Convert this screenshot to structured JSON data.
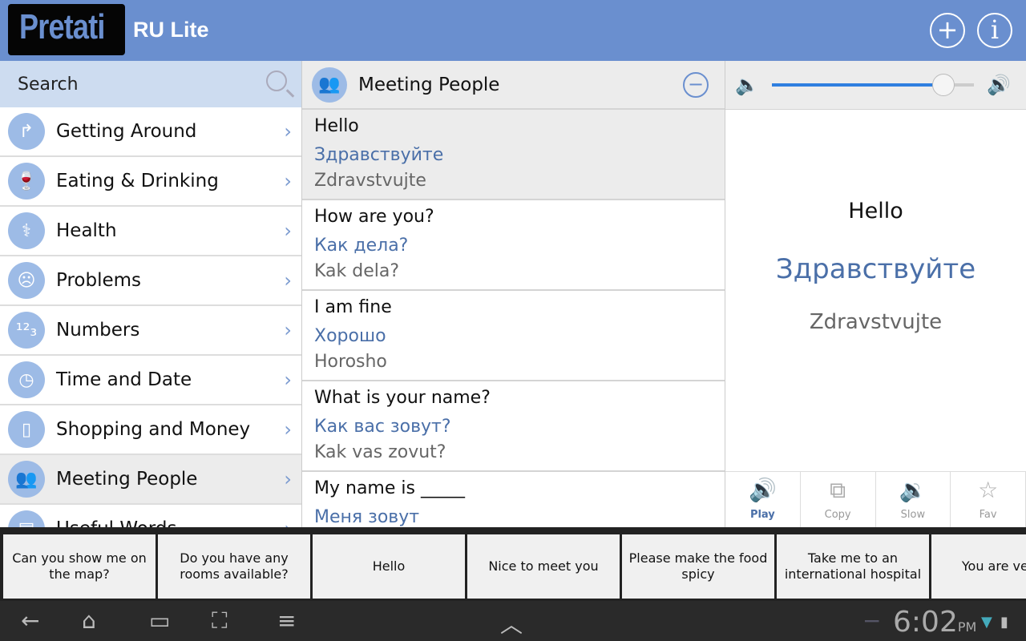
{
  "header": {
    "logo": "Pretati",
    "title": "RU Lite",
    "add_icon": "plus-circle",
    "info_icon": "info-circle"
  },
  "search": {
    "placeholder": "Search"
  },
  "categories": [
    {
      "label": "Getting Around",
      "icon": "↱"
    },
    {
      "label": "Eating & Drinking",
      "icon": "🍷"
    },
    {
      "label": "Health",
      "icon": "⚕"
    },
    {
      "label": "Problems",
      "icon": "☹"
    },
    {
      "label": "Numbers",
      "icon": "¹²₃"
    },
    {
      "label": "Time and Date",
      "icon": "◷"
    },
    {
      "label": "Shopping and Money",
      "icon": "▯"
    },
    {
      "label": "Meeting People",
      "icon": "👥"
    },
    {
      "label": "Useful Words",
      "icon": "▤"
    }
  ],
  "phrase_list": {
    "title": "Meeting People",
    "phrases": [
      {
        "en": "Hello",
        "ru": "Здравствуйте",
        "tr": "Zdravstvujte"
      },
      {
        "en": "How are you?",
        "ru": "Как дела?",
        "tr": "Kak dela?"
      },
      {
        "en": "I am fine",
        "ru": "Хорошо",
        "tr": "Horosho"
      },
      {
        "en": "What is your name?",
        "ru": "Как вас зовут?",
        "tr": "Kak vas zovut?"
      },
      {
        "en": "My name is _____",
        "ru": "Меня зовут",
        "tr": ""
      }
    ]
  },
  "detail": {
    "volume_percent": 85,
    "en": "Hello",
    "ru": "Здравствуйте",
    "tr": "Zdravstvujte",
    "actions": [
      {
        "label": "Play",
        "icon": "🔊"
      },
      {
        "label": "Copy",
        "icon": "⧉"
      },
      {
        "label": "Slow",
        "icon": "🔉"
      },
      {
        "label": "Fav",
        "icon": "☆"
      }
    ]
  },
  "quick_phrases": [
    "Can you show me on the map?",
    "Do you have any rooms available?",
    "Hello",
    "Nice to meet you",
    "Please make the food spicy",
    "Take me to an international hospital",
    "You are very b"
  ],
  "system": {
    "time": "6:02",
    "ampm": "PM"
  }
}
